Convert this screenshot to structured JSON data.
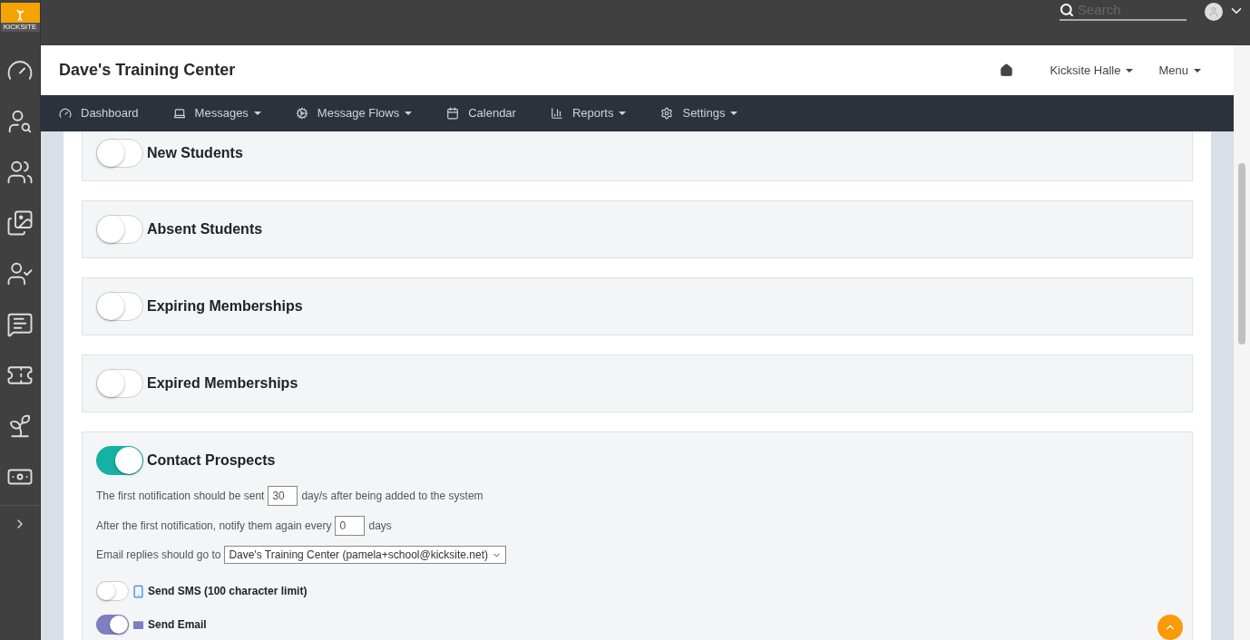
{
  "logo": {
    "text": "KICKSITE"
  },
  "top_bar": {
    "search": {
      "placeholder": "Search"
    }
  },
  "header": {
    "title": "Dave's Training Center",
    "links": [
      {
        "label": "Kicksite Halle",
        "dropdown": true
      },
      {
        "label": "Menu",
        "dropdown": true
      }
    ]
  },
  "nav": [
    {
      "label": "Dashboard",
      "kind": "dashboard",
      "dropdown": false
    },
    {
      "label": "Messages",
      "kind": "laptop",
      "dropdown": true
    },
    {
      "label": "Message Flows",
      "kind": "cogs",
      "dropdown": true
    },
    {
      "label": "Calendar",
      "kind": "calendar",
      "dropdown": false
    },
    {
      "label": "Reports",
      "kind": "chart",
      "dropdown": true
    },
    {
      "label": "Settings",
      "kind": "settings",
      "dropdown": true
    }
  ],
  "sections": [
    {
      "title": "New Students",
      "on": false
    },
    {
      "title": "Absent Students",
      "on": false
    },
    {
      "title": "Expiring Memberships",
      "on": false
    },
    {
      "title": "Expired Memberships",
      "on": false
    },
    {
      "title": "Contact Prospects",
      "on": true,
      "settings": {
        "first_before": "The first notification should be sent",
        "first_value": "30",
        "first_after": "day/s after being added to the system",
        "again_before": "After the first notification, notify them again every",
        "again_value": "0",
        "again_after": "days",
        "reply_label": "Email replies should go to",
        "reply_value": "Dave's Training Center (pamela+school@kicksite.net)"
      },
      "channels": [
        {
          "kind": "sms",
          "label": "Send SMS (100 character limit)",
          "on": false
        },
        {
          "kind": "email",
          "label": "Send Email",
          "on": true
        }
      ]
    }
  ]
}
